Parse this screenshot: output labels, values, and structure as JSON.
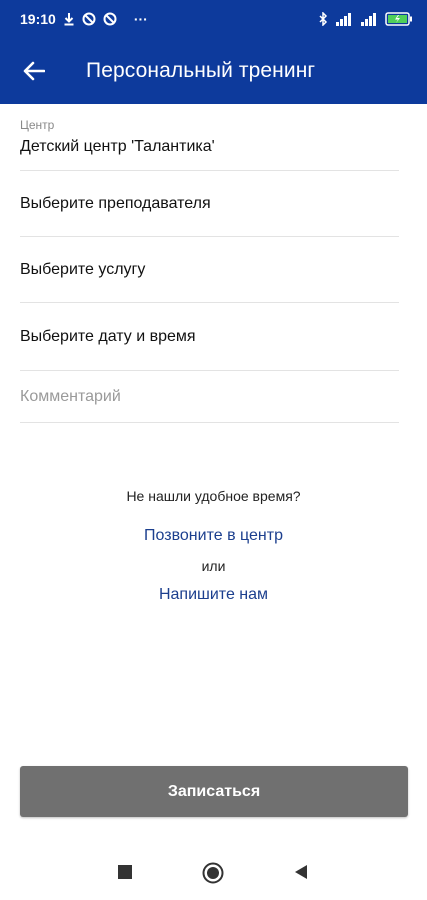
{
  "status_bar": {
    "time": "19:10",
    "more": "···"
  },
  "app_bar": {
    "title": "Персональный тренинг"
  },
  "form": {
    "center_label": "Центр",
    "center_value": "Детский центр 'Талантика'",
    "teacher_select": "Выберите преподавателя",
    "service_select": "Выберите услугу",
    "datetime_select": "Выберите дату и время",
    "comment_placeholder": "Комментарий"
  },
  "help": {
    "question": "Не нашли удобное время?",
    "call_link": "Позвоните в центр",
    "or": "или",
    "write_link": "Напишите нам"
  },
  "submit_label": "Записаться",
  "colors": {
    "primary": "#0d3a9c",
    "link": "#1c3f8e",
    "button": "#707070"
  }
}
